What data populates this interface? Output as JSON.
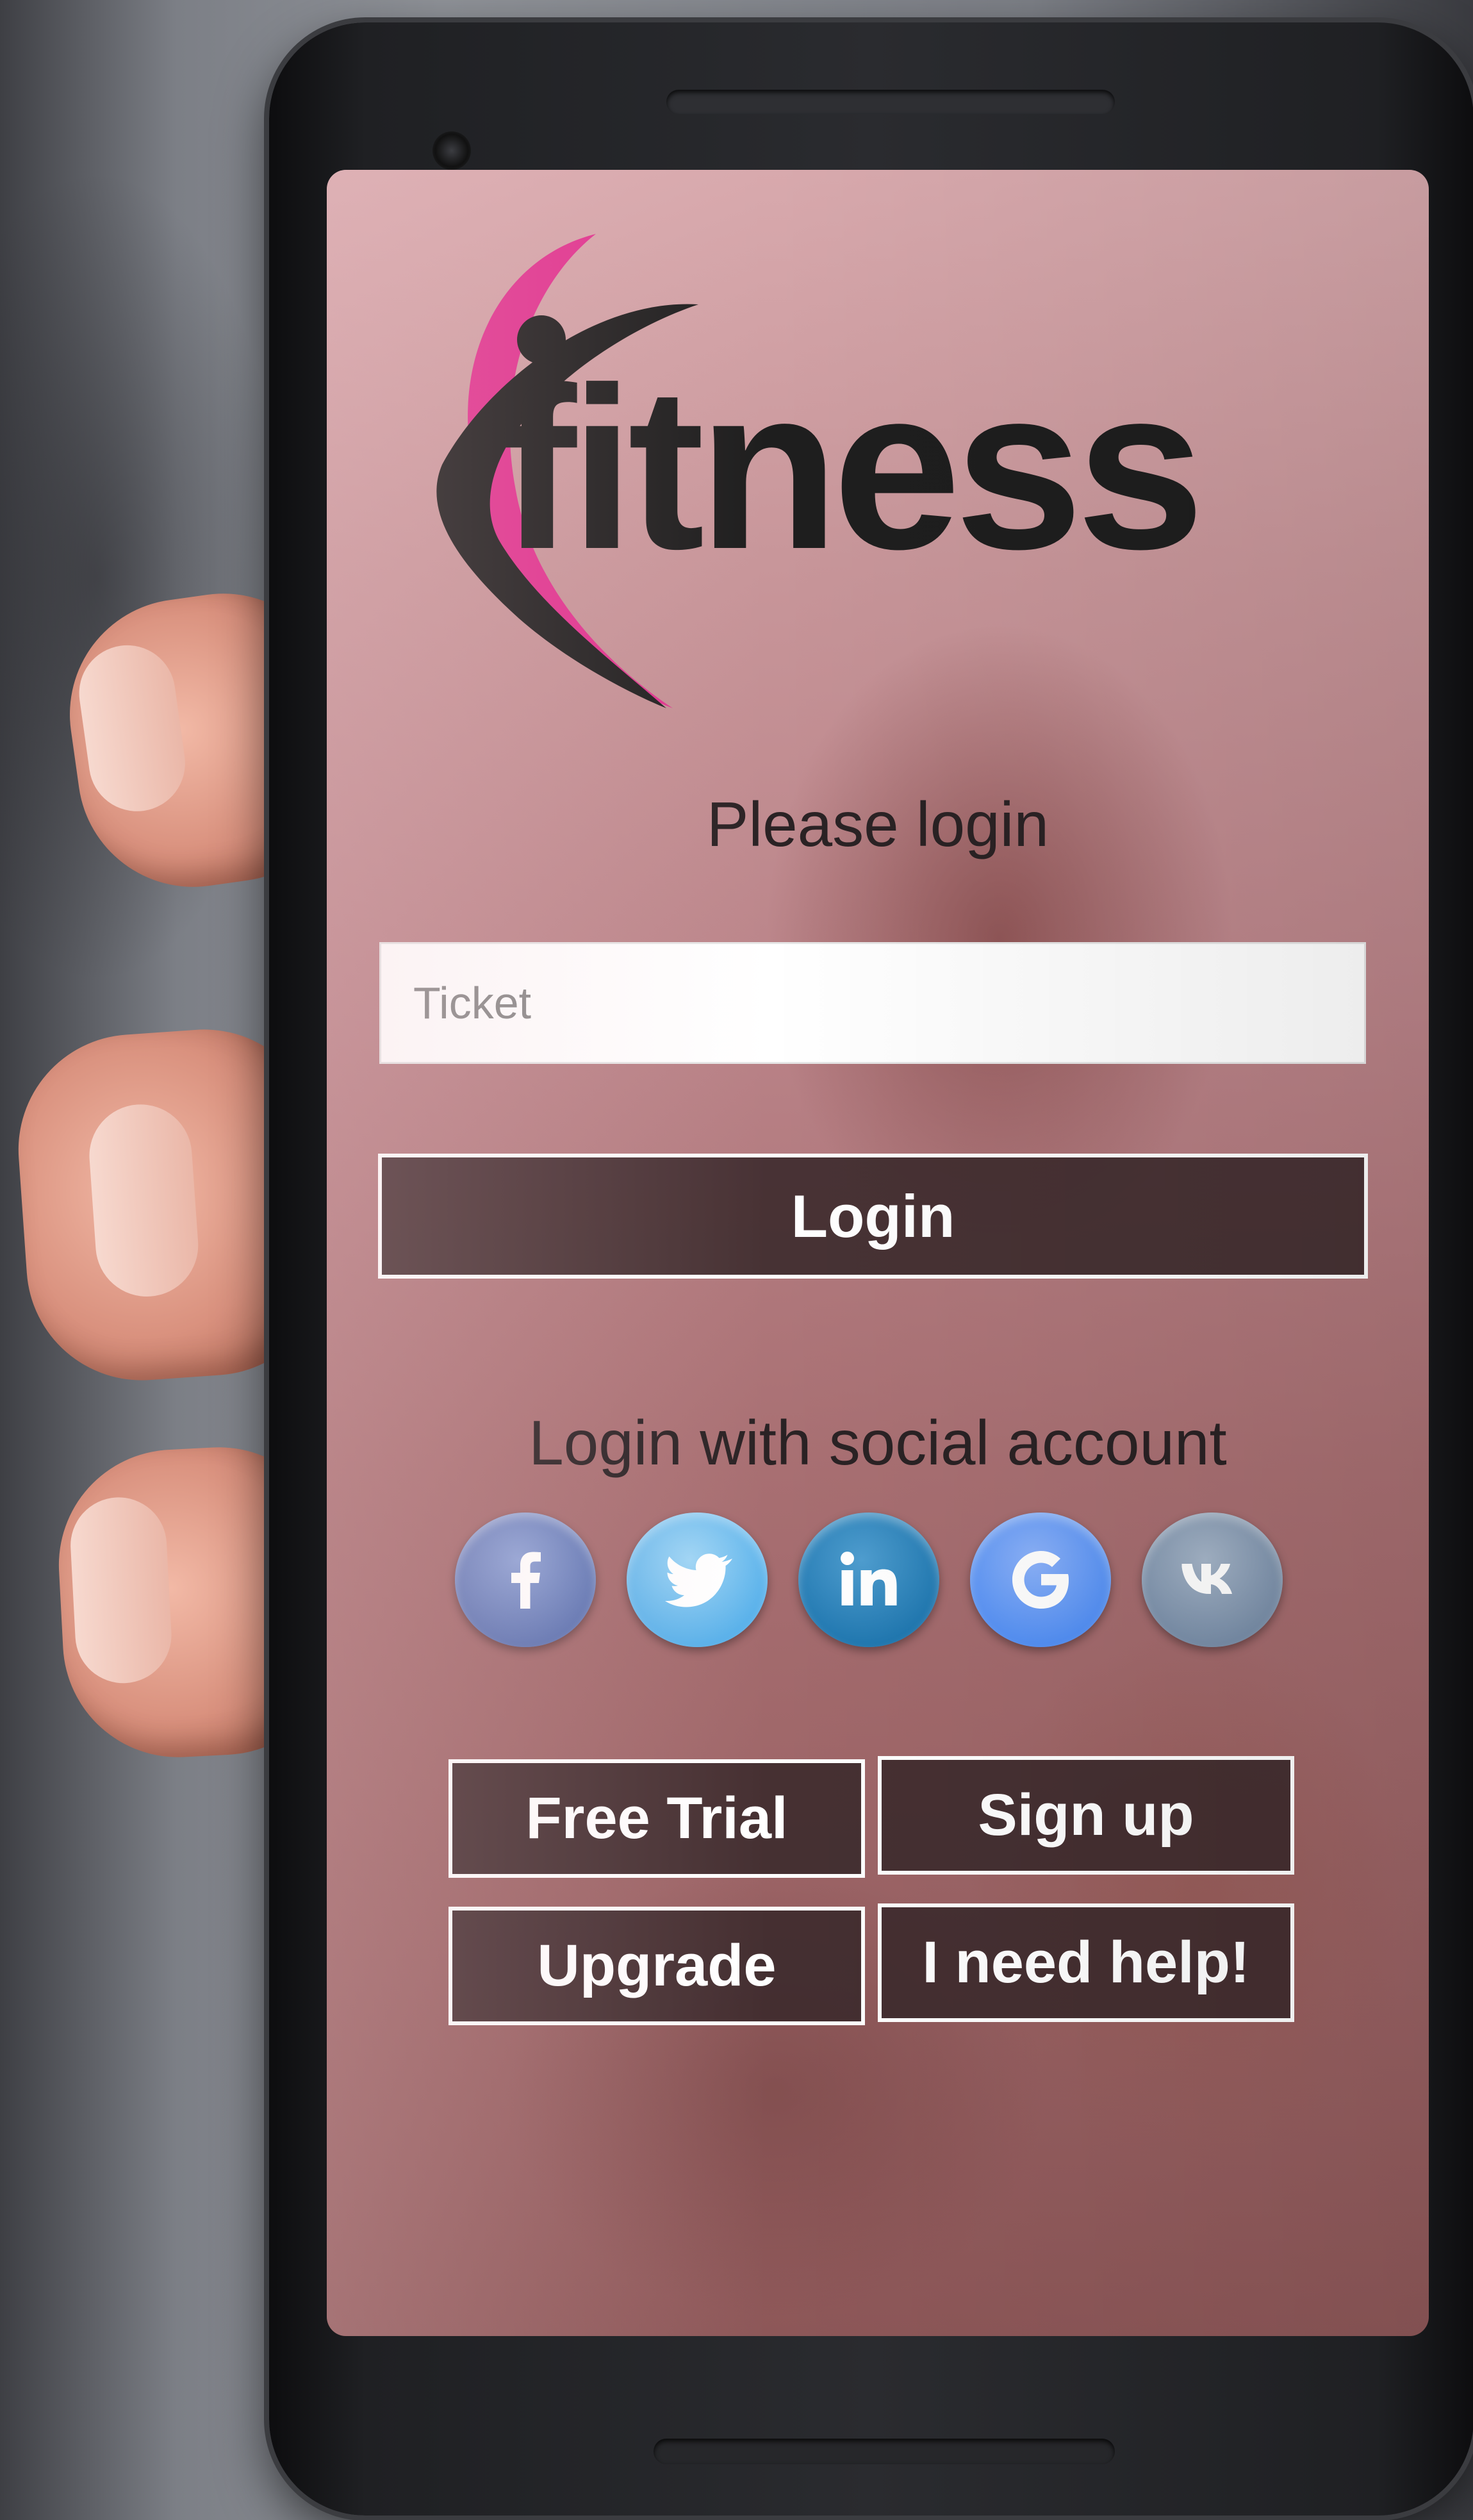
{
  "logo": {
    "text": "fitness",
    "accent_color": "#e0338f",
    "text_color": "#1e1e1e"
  },
  "login": {
    "title": "Please login",
    "ticket_placeholder": "Ticket",
    "ticket_value": "",
    "login_button": "Login"
  },
  "social": {
    "title": "Login with social account",
    "providers": [
      {
        "name": "facebook",
        "icon": "facebook-icon",
        "color": "#5870b4"
      },
      {
        "name": "twitter",
        "icon": "twitter-icon",
        "color": "#55b4ee"
      },
      {
        "name": "linkedin",
        "icon": "linkedin-icon",
        "color": "#1d7ab6"
      },
      {
        "name": "google",
        "icon": "google-icon",
        "color": "#4f8df5"
      },
      {
        "name": "vk",
        "icon": "vk-icon",
        "color": "#7a8fab"
      }
    ]
  },
  "actions": {
    "free_trial": "Free Trial",
    "sign_up": "Sign up",
    "upgrade": "Upgrade",
    "help": "I need help!"
  }
}
